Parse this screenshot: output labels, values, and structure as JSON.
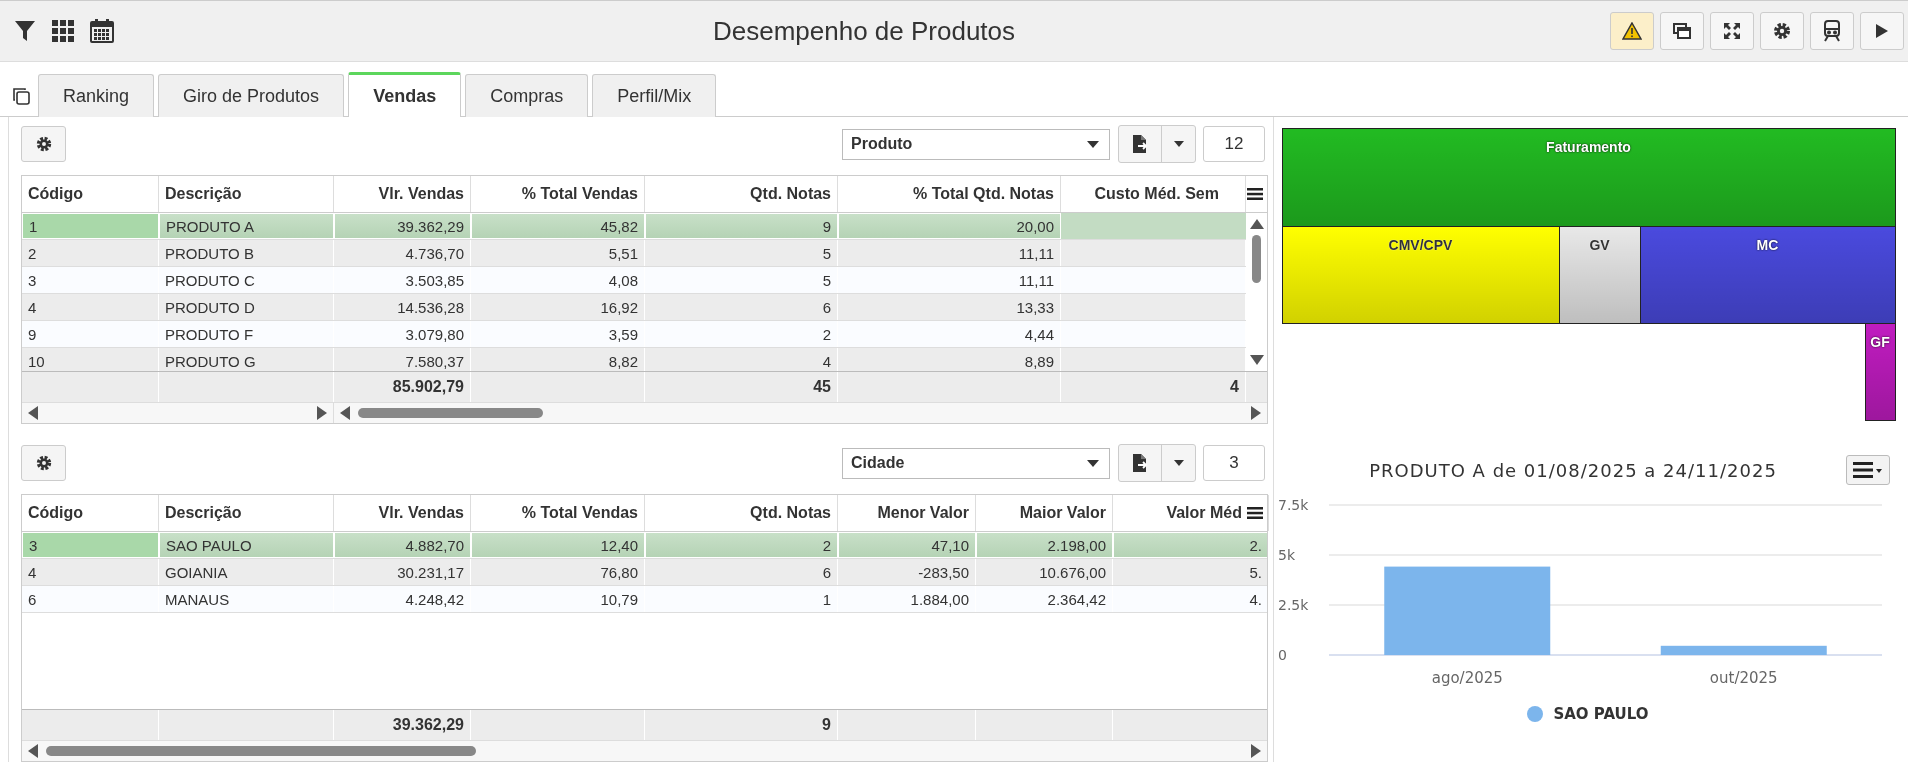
{
  "title": "Desempenho de Produtos",
  "tabs": [
    {
      "label": "Ranking",
      "selected": false
    },
    {
      "label": "Giro de Produtos",
      "selected": false
    },
    {
      "label": "Vendas",
      "selected": true
    },
    {
      "label": "Compras",
      "selected": false
    },
    {
      "label": "Perfil/Mix",
      "selected": false
    }
  ],
  "grids": [
    {
      "group_by": "Produto",
      "count": "12",
      "columns": [
        "Código",
        "Descrição",
        "Vlr. Vendas",
        "% Total Vendas",
        "Qtd. Notas",
        "% Total Qtd. Notas",
        "Custo Méd. Sem"
      ],
      "rows": [
        {
          "selected": true,
          "cells": [
            "1",
            "PRODUTO A",
            "39.362,29",
            "45,82",
            "9",
            "20,00",
            null
          ]
        },
        {
          "selected": false,
          "cells": [
            "2",
            "PRODUTO B",
            "4.736,70",
            "5,51",
            "5",
            "11,11",
            null
          ]
        },
        {
          "selected": false,
          "cells": [
            "3",
            "PRODUTO C",
            "3.503,85",
            "4,08",
            "5",
            "11,11",
            null
          ]
        },
        {
          "selected": false,
          "cells": [
            "4",
            "PRODUTO D",
            "14.536,28",
            "16,92",
            "6",
            "13,33",
            null
          ]
        },
        {
          "selected": false,
          "cells": [
            "9",
            "PRODUTO F",
            "3.079,80",
            "3,59",
            "2",
            "4,44",
            null
          ]
        },
        {
          "selected": false,
          "cells": [
            "10",
            "PRODUTO G",
            "7.580,37",
            "8,82",
            "4",
            "8,89",
            null
          ]
        }
      ],
      "totals": {
        "vlr_vendas": "85.902,79",
        "qtd_notas": "45",
        "column_7": "4"
      }
    },
    {
      "group_by": "Cidade",
      "count": "3",
      "columns": [
        "Código",
        "Descrição",
        "Vlr. Vendas",
        "% Total Vendas",
        "Qtd. Notas",
        "Menor Valor",
        "Maior Valor",
        "Valor Méd"
      ],
      "rows": [
        {
          "selected": true,
          "cells": [
            "3",
            "SAO PAULO",
            "4.882,70",
            "12,40",
            "2",
            "47,10",
            "2.198,00",
            "2."
          ]
        },
        {
          "selected": false,
          "cells": [
            "4",
            "GOIANIA",
            "30.231,17",
            "76,80",
            "6",
            "-283,50",
            "10.676,00",
            "5."
          ]
        },
        {
          "selected": false,
          "cells": [
            "6",
            "MANAUS",
            "4.248,42",
            "10,79",
            "1",
            "1.884,00",
            "2.364,42",
            "4."
          ]
        }
      ],
      "totals": {
        "vlr_vendas": "39.362,29",
        "qtd_notas": "9"
      }
    }
  ],
  "treemap": {
    "blocks": [
      {
        "label": "Faturamento",
        "color": "#22bb22"
      },
      {
        "label": "CMV/CPV",
        "color": "#ffff00"
      },
      {
        "label": "GV",
        "color": "#e8e8e8"
      },
      {
        "label": "MC",
        "color": "#4a4ade"
      },
      {
        "label": "GF",
        "color": "#c01cc0"
      }
    ]
  },
  "chart": {
    "chart_data": {
      "type": "bar",
      "title": "PRODUTO A de 01/08/2025 a 24/11/2025",
      "categories": [
        "ago/2025",
        "out/2025"
      ],
      "series": [
        {
          "name": "SAO PAULO",
          "color": "#7cb5ec",
          "values": [
            4420,
            460
          ]
        }
      ],
      "ylim": [
        0,
        7500
      ],
      "yticks": [
        {
          "value": 0,
          "label": "0"
        },
        {
          "value": 2500,
          "label": "2.5k"
        },
        {
          "value": 5000,
          "label": "5k"
        },
        {
          "value": 7500,
          "label": "7.5k"
        }
      ]
    }
  }
}
